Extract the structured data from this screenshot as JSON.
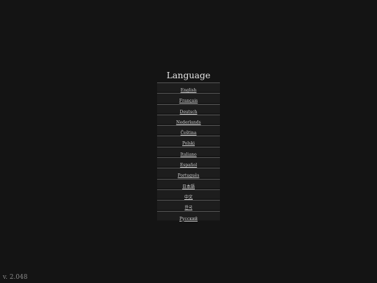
{
  "language_menu": {
    "title": "Language",
    "items": [
      {
        "label": "English"
      },
      {
        "label": "Français"
      },
      {
        "label": "Deutsch"
      },
      {
        "label": "Nederlands"
      },
      {
        "label": "Čeština"
      },
      {
        "label": "Polski"
      },
      {
        "label": "Italiano"
      },
      {
        "label": "Español"
      },
      {
        "label": "Português"
      },
      {
        "label": "日本語"
      },
      {
        "label": "中文"
      },
      {
        "label": "한국"
      },
      {
        "label": "Русский"
      }
    ]
  },
  "footer": {
    "version": "v. 2.048"
  }
}
